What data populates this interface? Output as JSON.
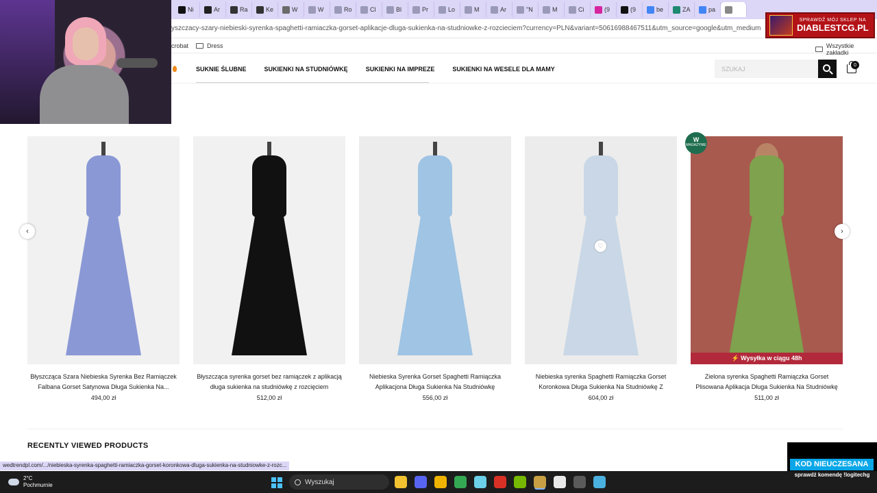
{
  "browser": {
    "tabs": [
      {
        "label": "Ni",
        "color": "#111111"
      },
      {
        "label": "Ar",
        "color": "#222222"
      },
      {
        "label": "Ra",
        "color": "#333333"
      },
      {
        "label": "Ke",
        "color": "#333333"
      },
      {
        "label": "W",
        "color": "#6a6a6a"
      },
      {
        "label": "W",
        "color": "#9a9ab8"
      },
      {
        "label": "Ro",
        "color": "#9a9ab8"
      },
      {
        "label": "Cl",
        "color": "#9a9ab8"
      },
      {
        "label": "Bl",
        "color": "#9a9ab8"
      },
      {
        "label": "Pr",
        "color": "#9a9ab8"
      },
      {
        "label": "Lo",
        "color": "#9a9ab8"
      },
      {
        "label": "M",
        "color": "#9a9ab8"
      },
      {
        "label": "Ar",
        "color": "#9a9ab8"
      },
      {
        "label": "\"N",
        "color": "#9a9ab8"
      },
      {
        "label": "M",
        "color": "#9a9ab8"
      },
      {
        "label": "Ci",
        "color": "#9a9ab8"
      },
      {
        "label": "(9",
        "color": "#d6249f"
      },
      {
        "label": "(9",
        "color": "#111111"
      },
      {
        "label": "be",
        "color": "#4285f4"
      },
      {
        "label": "ZA",
        "color": "#1f8a70"
      },
      {
        "label": "pa",
        "color": "#4285f4"
      },
      {
        "label": "",
        "color": "#888888"
      }
    ],
    "url": "yszczacy-szary-niebieski-syrenka-spaghetti-ramiaczka-gorset-aplikacje-dluga-sukienka-na-studniowke-z-rozcieciem?currency=PLN&variant=50616988467511&utm_source=google&utm_medium=cpc&utm_c...",
    "bookmarks": {
      "left_item": "crobat",
      "dress": "Dress",
      "all": "Wszystkie zakładki"
    }
  },
  "ad": {
    "small": "SPRAWDŹ MÓJ SKLEP NA",
    "big": "DIABLESTCG.PL"
  },
  "nav": {
    "items": [
      "SUKNIE ŚLUBNE",
      "SUKIENKI NA STUDNIÓWKĘ",
      "SUKIENKI NA IMPREZE",
      "SUKIENKI NA WESELE DLA MAMY"
    ],
    "search_placeholder": "SZUKAJ",
    "cart_count": "0"
  },
  "products": [
    {
      "name": "Błyszcząca Szara Niebieska Syrenka Bez Ramiączek Falbana Gorset Satynowa Długa Sukienka Na...",
      "price": "494,00 zł",
      "bg": "#f1f1f1",
      "dress": "#8a98d6",
      "model": false
    },
    {
      "name": "Błyszcząca syrenka gorset bez ramiączek z aplikacją długa sukienka na studniówkę z rozcięciem",
      "price": "512,00 zł",
      "bg": "#f1f1f1",
      "dress": "#111111",
      "model": false
    },
    {
      "name": "Niebieska Syrenka Gorset Spaghetti Ramiączka Aplikacjona Długa Sukienka Na Studniówkę",
      "price": "556,00 zł",
      "bg": "#ececec",
      "dress": "#9fc4e4",
      "model": false
    },
    {
      "name": "Niebieska syrenka Spaghetti Ramiączka Gorset Koronkowa Długa Sukienka Na Studniówkę Z Rozcięciem",
      "price": "604,00 zł",
      "bg": "#ececec",
      "dress": "#c9d7e6",
      "model": false
    },
    {
      "name": "Zielona syrenka Spaghetti Ramiączka Gorset Plisowana Aplikacja Długa Sukienka Na Studniówkę Z Rozcięciem",
      "price": "511,00 zł",
      "bg": "#a85a4f",
      "dress": "#7ea24d",
      "model": true,
      "badge_big": "W",
      "badge_small": "MAGAZYNIE",
      "ship": "⚡ Wysyłka w ciągu 48h"
    }
  ],
  "section_title": "RECENTLY VIEWED PRODUCTS",
  "status_link": "wedtrendpl.com/.../niebieska-syrenka-spaghetti-ramiaczka-gorset-koronkowa-dluga-sukienka-na-studniowke-z-rozc...",
  "promo": {
    "title": "KOD NIEUCZESANA",
    "sub": "sprawdź komendę !logitechg"
  },
  "taskbar": {
    "temp": "2°C",
    "condition": "Pochmurnie",
    "search": "Wyszukaj",
    "apps": [
      "#f2c230",
      "#5865f2",
      "#f0b400",
      "#34a853",
      "#6bd0e8",
      "#d93025",
      "#76b900",
      "#c8a043",
      "#e9e9e9",
      "#5a5a5a",
      "#4ab0e0"
    ]
  }
}
